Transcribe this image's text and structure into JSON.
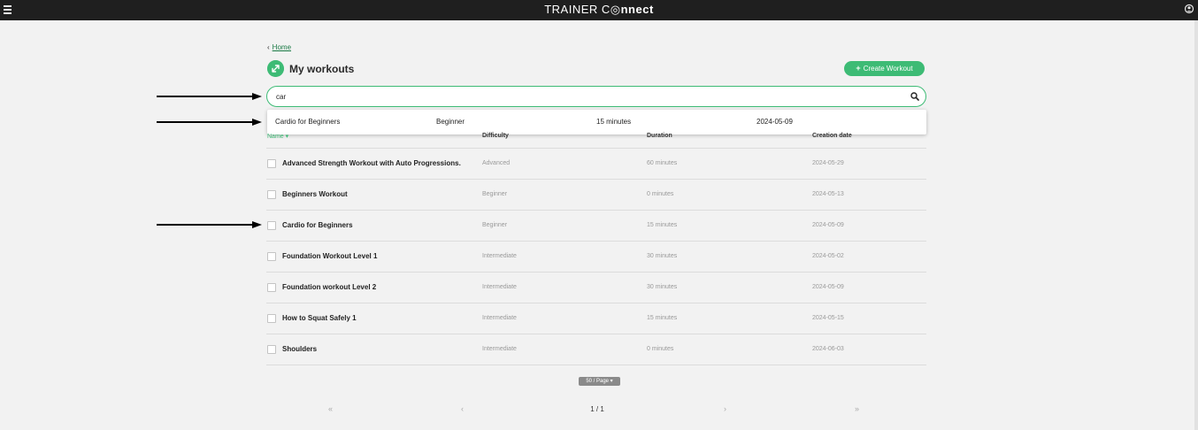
{
  "header": {
    "brand_part1": "TRAINER C",
    "brand_part2": "◎nnect"
  },
  "breadcrumb": {
    "chevron": "‹",
    "home_label": "Home"
  },
  "page": {
    "title": "My workouts",
    "create_button_label": "Create Workout",
    "create_button_icon": "+"
  },
  "search": {
    "value": "car",
    "placeholder": ""
  },
  "suggestion": {
    "name": "Cardio for Beginners",
    "difficulty": "Beginner",
    "duration": "15 minutes",
    "date": "2024-05-09"
  },
  "table": {
    "headers": {
      "name": "Name ▾",
      "difficulty": "Difficulty",
      "duration": "Duration",
      "creation_date": "Creation date"
    },
    "rows": [
      {
        "name": "Advanced Strength Workout with Auto Progressions.",
        "difficulty": "Advanced",
        "duration": "60 minutes",
        "date": "2024-05-29"
      },
      {
        "name": "Beginners Workout",
        "difficulty": "Beginner",
        "duration": "0 minutes",
        "date": "2024-05-13"
      },
      {
        "name": "Cardio for Beginners",
        "difficulty": "Beginner",
        "duration": "15 minutes",
        "date": "2024-05-09"
      },
      {
        "name": "Foundation Workout Level 1",
        "difficulty": "Intermediate",
        "duration": "30 minutes",
        "date": "2024-05-02"
      },
      {
        "name": "Foundation workout Level 2",
        "difficulty": "Intermediate",
        "duration": "30 minutes",
        "date": "2024-05-09"
      },
      {
        "name": "How to Squat Safely 1",
        "difficulty": "Intermediate",
        "duration": "15 minutes",
        "date": "2024-05-15"
      },
      {
        "name": "Shoulders",
        "difficulty": "Intermediate",
        "duration": "0 minutes",
        "date": "2024-06-03"
      }
    ]
  },
  "pagination": {
    "page_size": "50 / Page",
    "first": "«",
    "prev": "‹",
    "current": "1 / 1",
    "next": "›",
    "last": "»"
  },
  "colors": {
    "accent": "#3dbb75",
    "topbar": "#1f1f1f",
    "background": "#f2f2f2"
  },
  "icons": [
    "menu-icon",
    "user-icon",
    "expand-icon",
    "search-icon",
    "plus-icon",
    "chevron-down-icon"
  ]
}
